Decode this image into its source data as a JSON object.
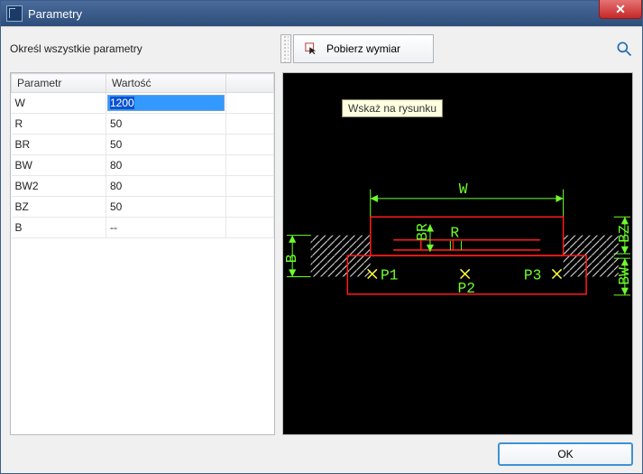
{
  "window": {
    "title": "Parametry"
  },
  "instruction": "Określ wszystkie parametry",
  "pick_button": {
    "label": "Pobierz wymiar",
    "tooltip": "Wskaż na rysunku"
  },
  "table": {
    "headers": {
      "param": "Parametr",
      "value": "Wartość"
    },
    "rows": [
      {
        "param": "W",
        "value": "1200",
        "editing": true
      },
      {
        "param": "R",
        "value": "50"
      },
      {
        "param": "BR",
        "value": "50"
      },
      {
        "param": "BW",
        "value": "80"
      },
      {
        "param": "BW2",
        "value": "80"
      },
      {
        "param": "BZ",
        "value": "50"
      },
      {
        "param": "B",
        "value": "--"
      }
    ]
  },
  "drawing": {
    "labels": {
      "W": "W",
      "B": "B",
      "BR": "BR",
      "R": "R",
      "BZ": "BZ",
      "BW": "BW",
      "P1": "P1",
      "P2": "P2",
      "P3": "P3"
    },
    "colors": {
      "dim": "#6cff2a",
      "geom": "#ff1a1a",
      "hatch": "#e8e8e8",
      "point": "#ffff33"
    }
  },
  "footer": {
    "ok": "OK"
  }
}
